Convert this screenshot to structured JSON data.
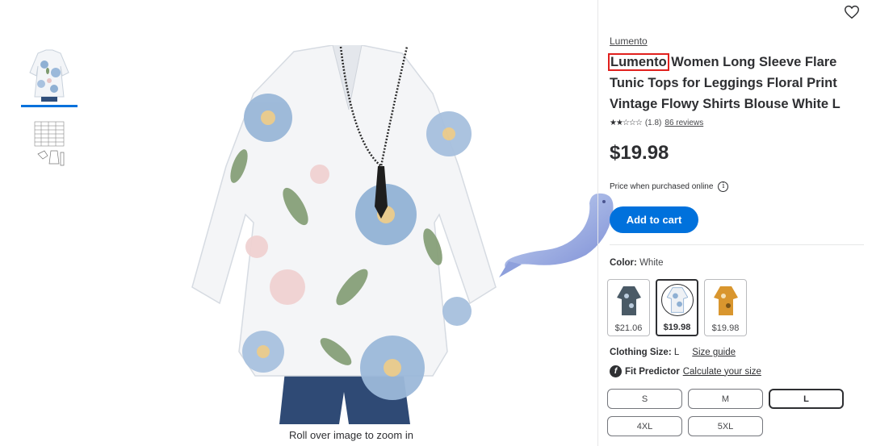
{
  "product": {
    "brand": "Lumento",
    "title_highlight": "Lumento",
    "title_rest": " Women Long Sleeve Flare Tunic Tops for Leggings Floral Print Vintage Flowy Shirts Blouse White L",
    "stars": "★★☆☆☆",
    "rating_text": "(1.8)",
    "reviews_text": "86 reviews",
    "price": "$19.98",
    "price_note": "Price when purchased online",
    "add_to_cart": "Add to cart"
  },
  "gallery": {
    "zoom_hint": "Roll over image to zoom in",
    "selected_index": 0
  },
  "color": {
    "label": "Color:",
    "value": "White",
    "swatches": [
      {
        "price": "$21.06",
        "selected": false,
        "fill": "#4a5a66"
      },
      {
        "price": "$19.98",
        "selected": true,
        "fill": "#8fb0d3"
      },
      {
        "price": "$19.98",
        "selected": false,
        "fill": "#d9962e"
      }
    ]
  },
  "clothing_size": {
    "label": "Clothing Size:",
    "value": "L",
    "guide_link": "Size guide"
  },
  "fit_predictor": {
    "label": "Fit Predictor",
    "link": "Calculate your size"
  },
  "sizes": [
    "S",
    "M",
    "L",
    "4XL",
    "5XL"
  ],
  "selected_size": "L",
  "colors": {
    "accent": "#0071dc",
    "highlight_box": "#e0201d"
  }
}
